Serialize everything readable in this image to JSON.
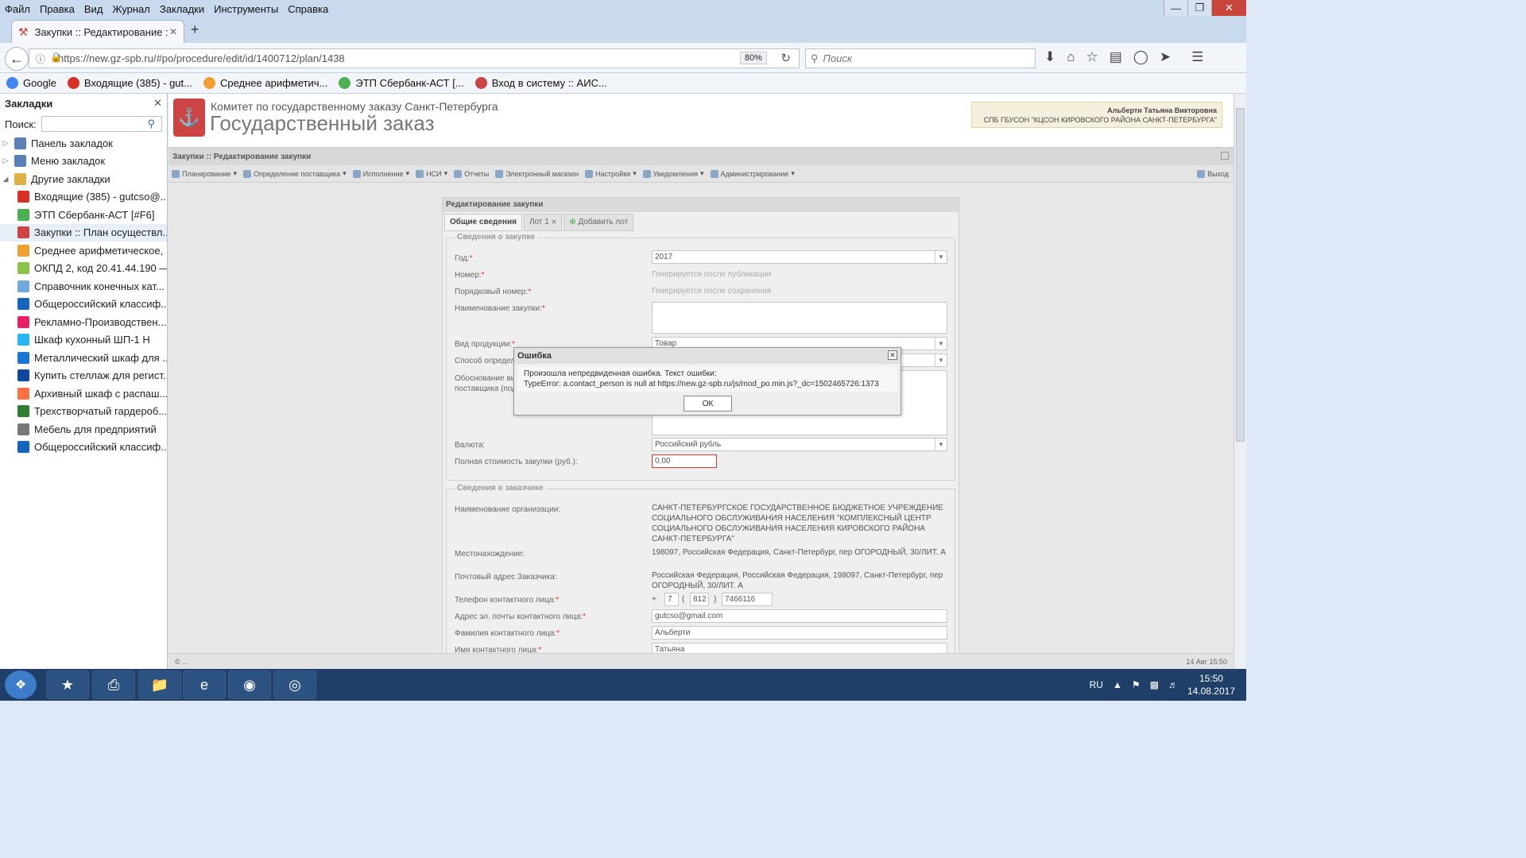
{
  "menubar": {
    "items": [
      "Файл",
      "Правка",
      "Вид",
      "Журнал",
      "Закладки",
      "Инструменты",
      "Справка"
    ]
  },
  "tab": {
    "title": "Закупки :: Редактирование :"
  },
  "nav": {
    "url": "https://new.gz-spb.ru/#po/procedure/edit/id/1400712/plan/1438",
    "zoom": "80%",
    "search_placeholder": "Поиск"
  },
  "bookmarks_bar": [
    {
      "label": "Google",
      "color": "#4285f4"
    },
    {
      "label": "Входящие (385) - gut...",
      "color": "#d93025"
    },
    {
      "label": "Среднее арифметич...",
      "color": "#f0a030"
    },
    {
      "label": "ЭТП Сбербанк-АСТ [...",
      "color": "#4caf50"
    },
    {
      "label": "Вход в систему :: АИС...",
      "color": "#c44"
    }
  ],
  "sidebar": {
    "title": "Закладки",
    "search_label": "Поиск:",
    "folders": [
      {
        "label": "Панель закладок",
        "color": "#5a7fb5"
      },
      {
        "label": "Меню закладок",
        "color": "#5a7fb5"
      },
      {
        "label": "Другие закладки",
        "color": "#e0b040"
      }
    ],
    "items": [
      {
        "label": "Входящие (385) - gutcso@...",
        "color": "#d93025"
      },
      {
        "label": "ЭТП Сбербанк-АСТ [#F6]",
        "color": "#4caf50"
      },
      {
        "label": "Закупки :: План осуществл...",
        "color": "#c44"
      },
      {
        "label": "Среднее арифметическое, ...",
        "color": "#f0a030"
      },
      {
        "label": "ОКПД 2, код 20.41.44.190 —...",
        "color": "#8bc34a"
      },
      {
        "label": "Справочник конечных кат...",
        "color": "#6fa8dc"
      },
      {
        "label": "Общероссийский классиф...",
        "color": "#1565c0"
      },
      {
        "label": "Рекламно-Производствен...",
        "color": "#e91e63"
      },
      {
        "label": "Шкаф кухонный ШП-1 Н",
        "color": "#29b6f6"
      },
      {
        "label": "Металлический шкаф для ...",
        "color": "#1976d2"
      },
      {
        "label": "Купить стеллаж для регист...",
        "color": "#0d47a1"
      },
      {
        "label": "Архивный шкаф с распаш...",
        "color": "#ff7043"
      },
      {
        "label": "Трехстворчатый гардероб...",
        "color": "#2e7d32"
      },
      {
        "label": "Мебель для предприятий",
        "color": "#777777"
      },
      {
        "label": "Общероссийский классиф...",
        "color": "#1565c0"
      }
    ]
  },
  "header": {
    "subtitle": "Комитет по государственному заказу Санкт-Петербурга",
    "title": "Государственный заказ",
    "user_name": "Альберти Татьяна Викторовна",
    "user_org": "СПБ ГБУСОН \"КЦСОН КИРОВСКОГО РАЙОНА САНКТ-ПЕТЕРБУРГА\""
  },
  "page_title": "Закупки :: Редактирование закупки",
  "toolbar": {
    "items": [
      "Планирование",
      "Определение поставщика",
      "Исполнение",
      "НСИ",
      "Отчеты",
      "Электронный магазин",
      "Настройки",
      "Уведомления",
      "Администрирование"
    ],
    "exit": "Выход"
  },
  "form": {
    "title": "Редактирование закупки",
    "tabs": [
      "Общие сведения",
      "Лот 1",
      "Добавить лот"
    ],
    "section1": "Сведения о закупке",
    "year_label": "Год:",
    "year_value": "2017",
    "number_label": "Номер:",
    "number_value": "Генерируется после публикации",
    "order_label": "Порядковый номер:",
    "order_value": "Генерируется после сохранения",
    "name_label": "Наименование закупки:",
    "product_label": "Вид продукции:",
    "product_value": "Товар",
    "method_label": "Способ определ",
    "basis_label1": "Обоснование вы",
    "basis_label2": "поставщика (под",
    "currency_label": "Валюта:",
    "currency_value": "Российский рубль",
    "cost_label": "Полная стоимость закупки (руб.):",
    "cost_value": "0,00",
    "section2": "Сведения о заказчике",
    "org_label": "Наименование организации:",
    "org_value": "САНКТ-ПЕТЕРБУРГСКОЕ ГОСУДАРСТВЕННОЕ БЮДЖЕТНОЕ УЧРЕЖДЕНИЕ СОЦИАЛЬНОГО ОБСЛУЖИВАНИЯ НАСЕЛЕНИЯ \"КОМПЛЕКСНЫЙ ЦЕНТР СОЦИАЛЬНОГО ОБСЛУЖИВАНИЯ НАСЕЛЕНИЯ КИРОВСКОГО РАЙОНА САНКТ-ПЕТЕРБУРГА\"",
    "loc_label": "Местонахождение:",
    "loc_value": "198097, Российская Федерация, Санкт-Петербург, пер ОГОРОДНЫЙ, 30/ЛИТ. А",
    "postal_label": "Почтовый адрес Заказчика:",
    "postal_value": "Российская Федерация, Российская Федерация, 198097, Санкт-Петербург, пер ОГОРОДНЫЙ, 30/ЛИТ. А",
    "phone_label": "Телефон контактного лица:",
    "phone_plus": "+",
    "phone_country": "7",
    "phone_code": "812",
    "phone_number": "7466116",
    "email_label": "Адрес эл. почты контактного лица:",
    "email_value": "gutcso@gmail.com",
    "lastname_label": "Фамилия контактного лица:",
    "lastname_value": "Альберти",
    "firstname_label": "Имя контактного лица:",
    "firstname_value": "Татьяна"
  },
  "dialog": {
    "title": "Ошибка",
    "line1": "Произошла непредвиденная ошибка. Текст ошибки:",
    "line2": "TypeError: a.contact_person is null at https://new.gz-spb.ru/js/mod_po.min.js?_dc=1502465726:1373",
    "ok": "ОК"
  },
  "footer": {
    "left": "© ...",
    "right": "14 Авг 15:50"
  },
  "taskbar": {
    "lang": "RU",
    "time": "15:50",
    "date": "14.08.2017"
  }
}
